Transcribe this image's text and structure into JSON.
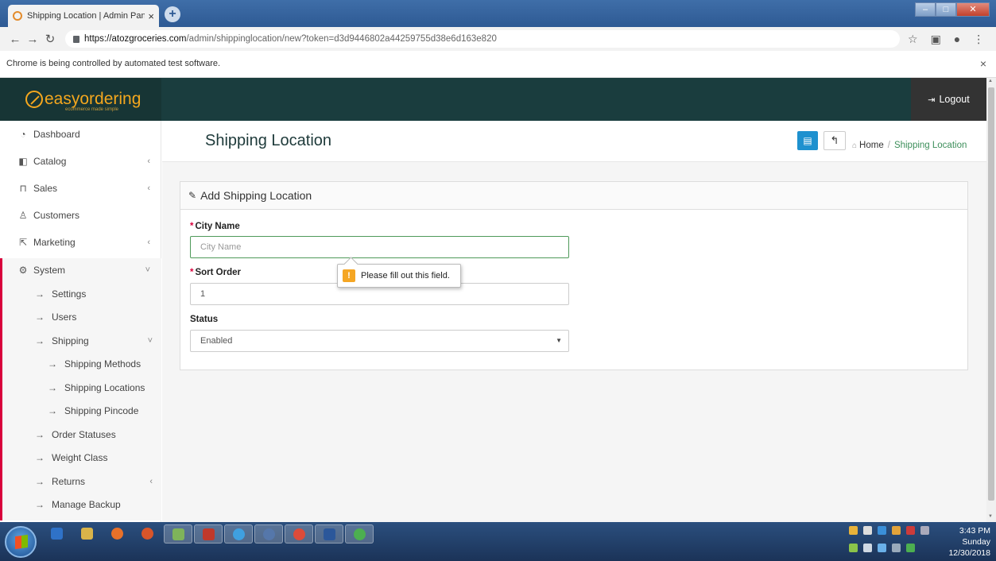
{
  "browser": {
    "tab_title": "Shipping Location | Admin Panel",
    "tab_close": "×",
    "new_tab": "+",
    "url_host": "https://atozgroceries.com",
    "url_path": "/admin/shippinglocation/new?token=d3d9446802a44259755d38e6d163e820",
    "infobar_text": "Chrome is being controlled by automated test software.",
    "infobar_close": "×"
  },
  "app": {
    "logo_text": "easyordering",
    "logo_tagline": "ecommerce made simple",
    "logout_label": "Logout"
  },
  "sidebar": {
    "items": [
      {
        "label": "Dashboard",
        "icon": "dashboard-icon"
      },
      {
        "label": "Catalog",
        "icon": "tag-icon"
      },
      {
        "label": "Sales",
        "icon": "cart-icon"
      },
      {
        "label": "Customers",
        "icon": "user-icon"
      },
      {
        "label": "Marketing",
        "icon": "share-icon"
      },
      {
        "label": "System",
        "icon": "gear-icon"
      }
    ],
    "system_items": [
      {
        "label": "Settings"
      },
      {
        "label": "Users"
      },
      {
        "label": "Shipping"
      },
      {
        "label": "Shipping Methods"
      },
      {
        "label": "Shipping Locations"
      },
      {
        "label": "Shipping Pincode"
      },
      {
        "label": "Order Statuses"
      },
      {
        "label": "Weight Class"
      },
      {
        "label": "Returns"
      },
      {
        "label": "Manage Backup"
      }
    ]
  },
  "page": {
    "title": "Shipping Location",
    "breadcrumb_home": "Home",
    "breadcrumb_separator": "/",
    "breadcrumb_current": "Shipping Location"
  },
  "form": {
    "panel_title": "Add Shipping Location",
    "city_label": "City Name",
    "city_placeholder": "City Name",
    "city_value": "",
    "sort_label": "Sort Order",
    "sort_value": "1",
    "status_label": "Status",
    "status_value": "Enabled",
    "required_mark": "*",
    "validation_message": "Please fill out this field.",
    "validation_icon": "!"
  },
  "taskbar": {
    "time": "3:43 PM",
    "day": "Sunday",
    "date": "12/30/2018"
  },
  "colors": {
    "topnav": "#1a3d3e",
    "accent_orange": "#f4a71e",
    "active_marker": "#d9003c",
    "primary_button": "#1e91cf",
    "breadcrumb_active": "#3d8f5b"
  }
}
